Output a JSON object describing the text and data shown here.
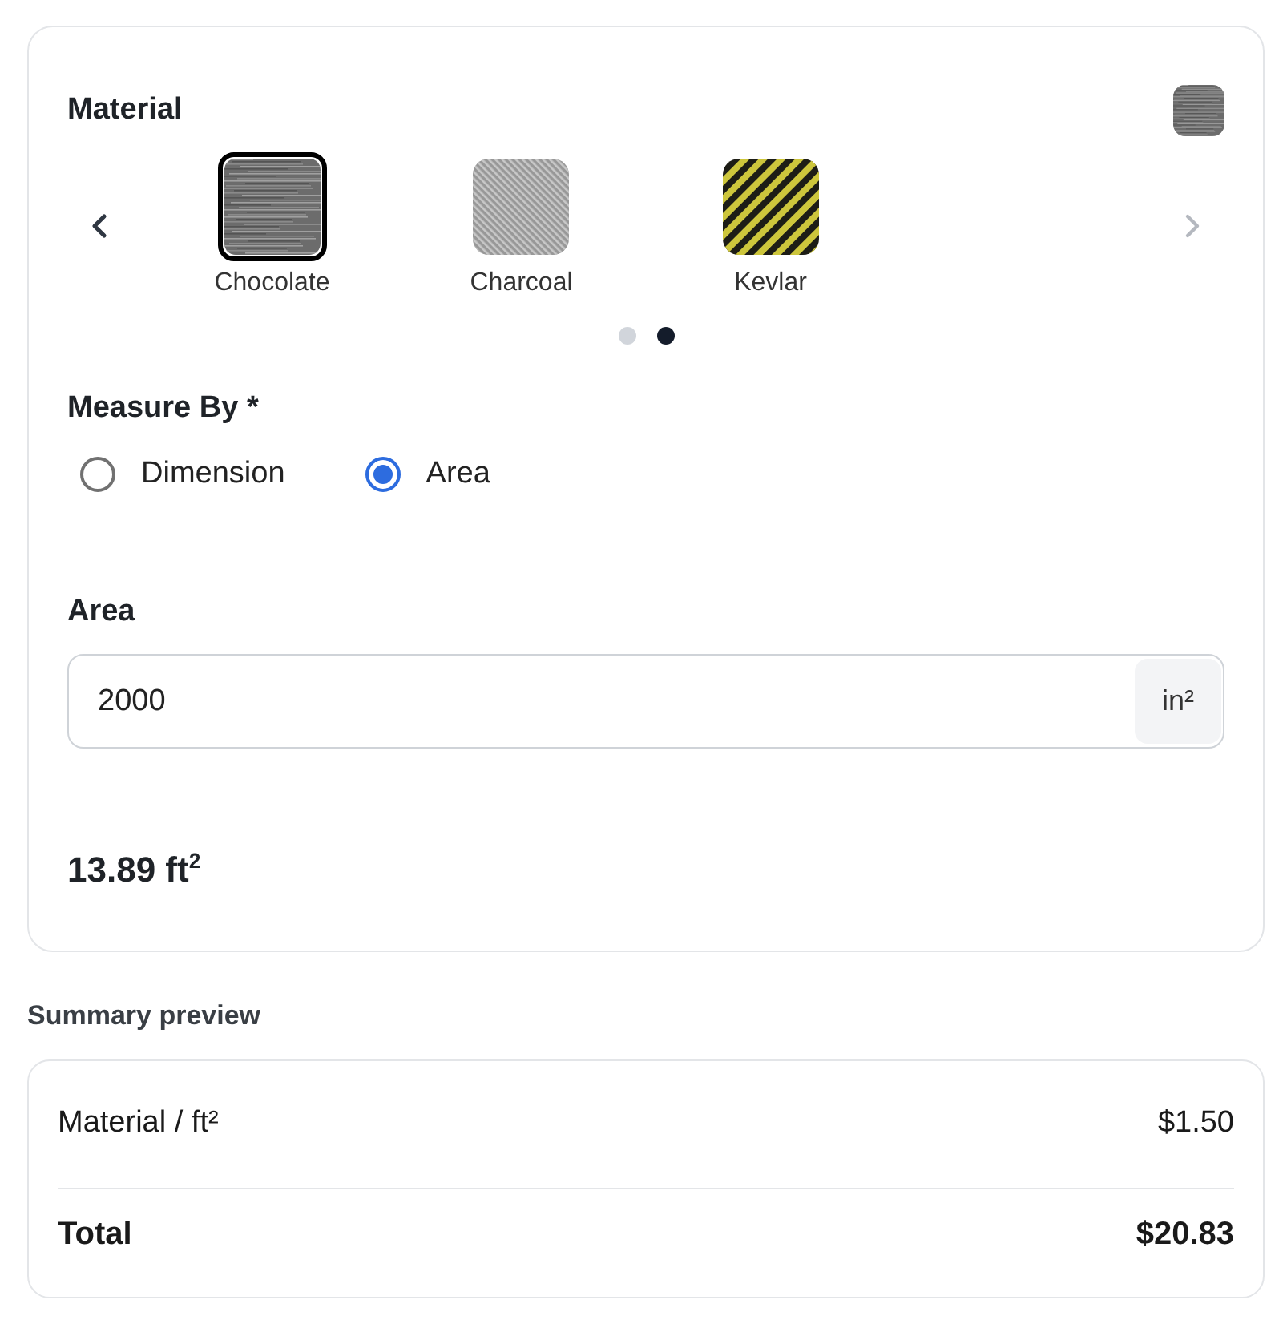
{
  "material": {
    "title": "Material",
    "items": [
      {
        "name": "Chocolate",
        "kind": "brushed",
        "selected": true
      },
      {
        "name": "Charcoal",
        "kind": "twill",
        "selected": false
      },
      {
        "name": "Kevlar",
        "kind": "stripes",
        "selected": false
      }
    ],
    "prev_disabled": false,
    "next_disabled": true,
    "pages": [
      {
        "selected": false
      },
      {
        "selected": true
      }
    ]
  },
  "measure_by": {
    "label": "Measure By *",
    "options": [
      {
        "label": "Dimension",
        "selected": false
      },
      {
        "label": "Area",
        "selected": true
      }
    ]
  },
  "area": {
    "label": "Area",
    "value": "2000",
    "unit": "in²"
  },
  "converted": "13.89 ft$^{2}$",
  "summary": {
    "title": "Summary preview",
    "rows": [
      {
        "kind": "item",
        "label": "Material / ft²",
        "value": "$1.50"
      },
      {
        "kind": "total",
        "label": "Total",
        "value": "$20.83"
      }
    ]
  }
}
